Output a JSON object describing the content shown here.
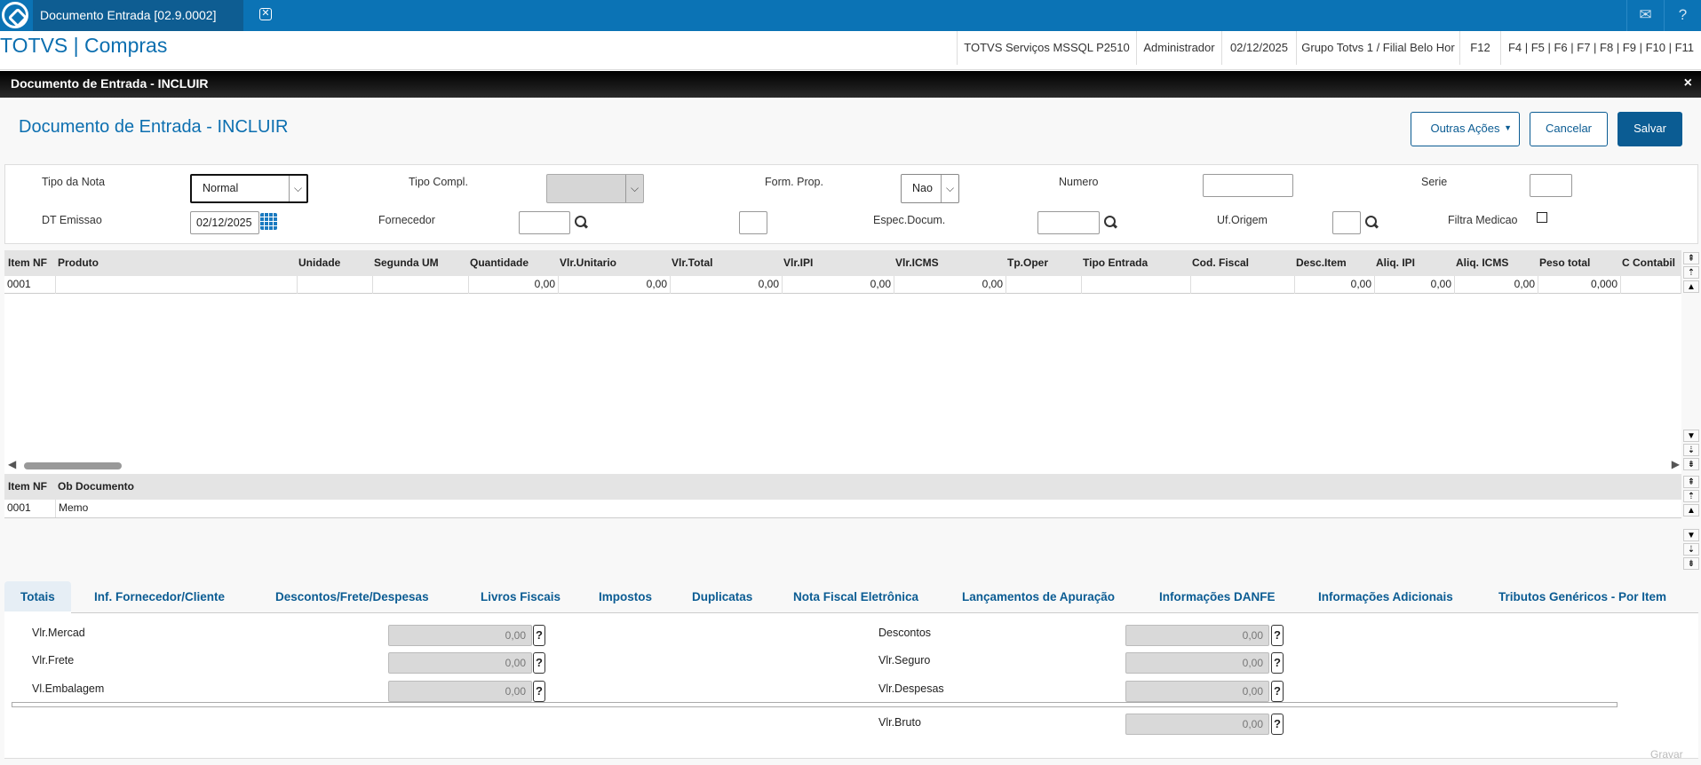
{
  "topbar": {
    "tab_title": "Documento Entrada [02.9.0002]",
    "tab_close": "✕",
    "mail_icon": "✉",
    "help_icon": "?"
  },
  "header": {
    "app_title": "TOTVS | Compras",
    "env": "TOTVS Serviços MSSQL P2510",
    "user": "Administrador",
    "date": "02/12/2025",
    "branch": "Grupo Totvs 1 / Filial Belo Hor",
    "f12": "F12",
    "fkeys": "F4 | F5 | F6 | F7 | F8 | F9 | F10 | F11"
  },
  "modal": {
    "title": "Documento de Entrada - INCLUIR",
    "close": "×"
  },
  "page": {
    "title": "Documento de Entrada - INCLUIR"
  },
  "actions": {
    "outras": "Outras Ações",
    "cancelar": "Cancelar",
    "salvar": "Salvar"
  },
  "form": {
    "tipo_nota_label": "Tipo da Nota",
    "tipo_nota_value": "Normal",
    "tipo_compl_label": "Tipo Compl.",
    "form_prop_label": "Form. Prop.",
    "form_prop_value": "Nao",
    "numero_label": "Numero",
    "serie_label": "Serie",
    "dt_emissao_label": "DT Emissao",
    "dt_emissao_value": "02/12/2025",
    "fornecedor_label": "Fornecedor",
    "espec_label": "Espec.Docum.",
    "uf_label": "Uf.Origem",
    "filtra_label": "Filtra Medicao"
  },
  "items_grid": {
    "headers": [
      "Item NF",
      "Produto",
      "Unidade",
      "Segunda UM",
      "Quantidade",
      "Vlr.Unitario",
      "Vlr.Total",
      "Vlr.IPI",
      "Vlr.ICMS",
      "Tp.Oper",
      "Tipo Entrada",
      "Cod. Fiscal",
      "Desc.Item",
      "Aliq. IPI",
      "Aliq. ICMS",
      "Peso total",
      "C Contabil"
    ],
    "row": [
      "0001",
      "",
      "",
      "",
      "0,00",
      "0,00",
      "0,00",
      "0,00",
      "0,00",
      "",
      "",
      "",
      "0,00",
      "0,00",
      "0,00",
      "0,000",
      ""
    ]
  },
  "obs_grid": {
    "headers": [
      "Item NF",
      "Ob Documento"
    ],
    "row": [
      "0001",
      "Memo"
    ]
  },
  "tabs": [
    "Totais",
    "Inf. Fornecedor/Cliente",
    "Descontos/Frete/Despesas",
    "Livros Fiscais",
    "Impostos",
    "Duplicatas",
    "Nota Fiscal Eletrônica",
    "Lançamentos de Apuração",
    "Informações DANFE",
    "Informações Adicionais",
    "Tributos Genéricos - Por Item"
  ],
  "totals": {
    "mercad_label": "Vlr.Mercad",
    "mercad_value": "0,00",
    "frete_label": "Vlr.Frete",
    "frete_value": "0,00",
    "embalagem_label": "Vl.Embalagem",
    "embalagem_value": "0,00",
    "descontos_label": "Descontos",
    "descontos_value": "0,00",
    "seguro_label": "Vlr.Seguro",
    "seguro_value": "0,00",
    "despesas_label": "Vlr.Despesas",
    "despesas_value": "0,00",
    "bruto_label": "Vlr.Bruto",
    "bruto_value": "0,00",
    "help_glyph": "?"
  },
  "footer": {
    "gravar": "Gravar"
  },
  "colors": {
    "brand": "#0b73b5",
    "accent": "#0b5c93"
  }
}
